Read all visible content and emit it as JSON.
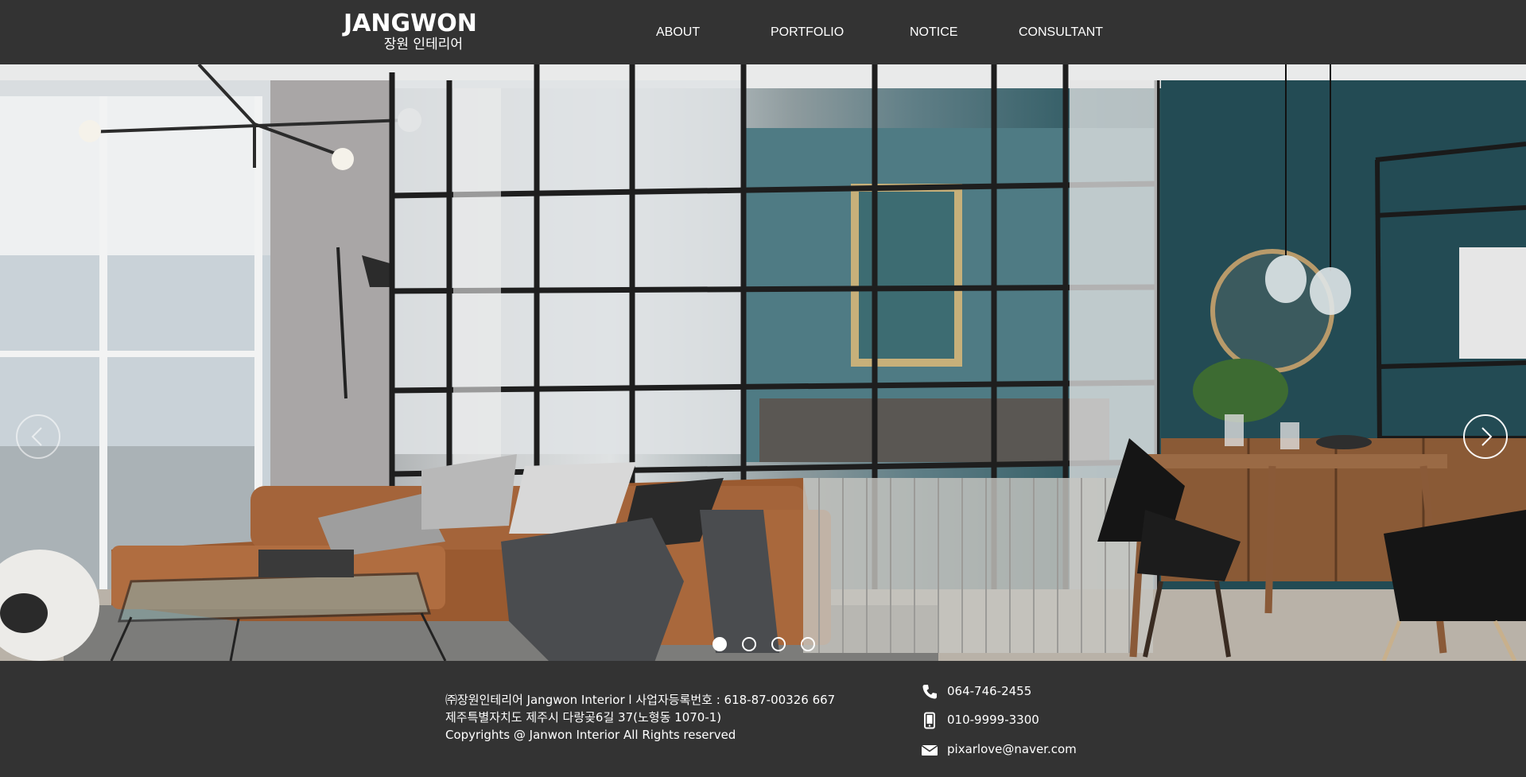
{
  "header": {
    "logo_main": "JANGWON",
    "logo_sub": "장원 인테리어",
    "nav": [
      {
        "label": "ABOUT"
      },
      {
        "label": "PORTFOLIO"
      },
      {
        "label": "NOTICE"
      },
      {
        "label": "CONSULTANT"
      }
    ]
  },
  "slider": {
    "active_slide": 1,
    "slide_count": 4,
    "prev_icon": "chevron-left-icon",
    "next_icon": "chevron-right-icon"
  },
  "footer": {
    "info_lines": [
      "㈜장원인테리어 Jangwon Interior l 사업자등록번호 : 618-87-00326 667",
      "제주특별자치도 제주시 다랑곶6길 37(노형동 1070-1)",
      "Copyrights @ Janwon Interior All Rights reserved"
    ],
    "contacts": [
      {
        "icon": "phone-icon",
        "text": "064-746-2455"
      },
      {
        "icon": "mobile-icon",
        "text": "010-9999-3300"
      },
      {
        "icon": "envelope-icon",
        "text": "pixarlove@naver.com"
      }
    ]
  },
  "colors": {
    "header_bg": "#333333",
    "footer_bg": "#333333",
    "text": "#ffffff"
  }
}
